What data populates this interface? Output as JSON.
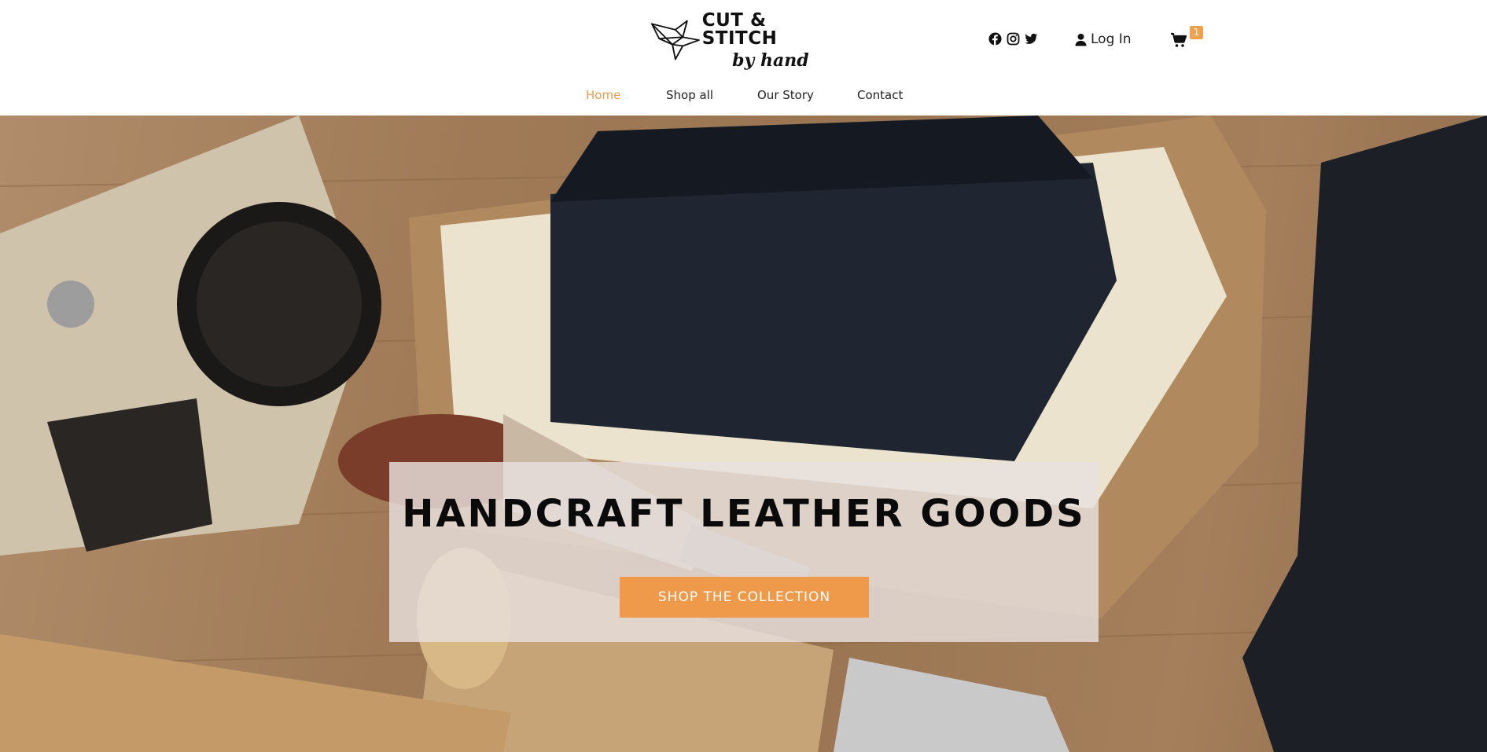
{
  "brand": {
    "title": "CUT & STITCH",
    "subtitle": "by hand",
    "logo_icon": "origami-bird-icon"
  },
  "header": {
    "social_icons": [
      "facebook-icon",
      "instagram-icon",
      "twitter-icon"
    ],
    "login_label": "Log In",
    "cart_count": "1"
  },
  "nav": {
    "items": [
      {
        "label": "Home",
        "active": true
      },
      {
        "label": "Shop all",
        "active": false
      },
      {
        "label": "Our Story",
        "active": false
      },
      {
        "label": "Contact",
        "active": false
      }
    ]
  },
  "hero": {
    "headline": "HANDCRAFT LEATHER GOODS",
    "cta_label": "SHOP THE COLLECTION"
  },
  "colors": {
    "accent": "#ee9a4a",
    "text": "#222222",
    "overlay": "#e8e0de"
  }
}
